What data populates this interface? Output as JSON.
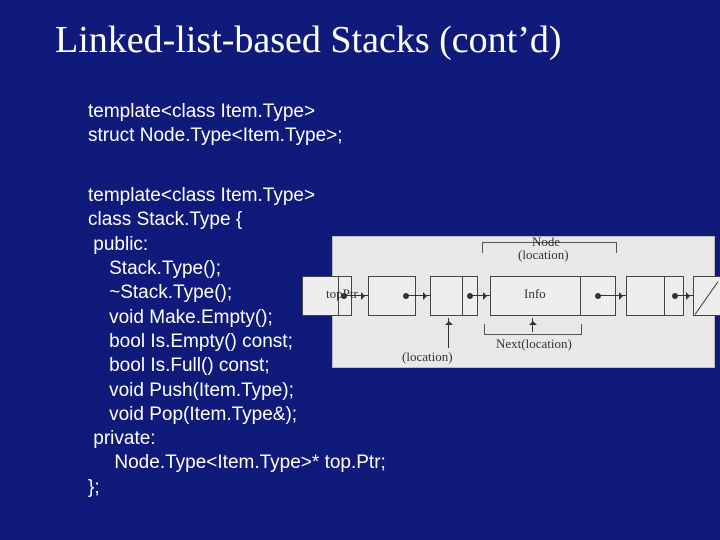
{
  "title": "Linked-list-based Stacks (cont’d)",
  "intro_lines": [
    "template<class Item.Type>",
    "struct Node.Type<Item.Type>;"
  ],
  "body_lines": [
    "template<class Item.Type>",
    "class Stack.Type {",
    " public:",
    "    Stack.Type();",
    "    ~Stack.Type();",
    "    void Make.Empty();",
    "    bool Is.Empty() const;",
    "    bool Is.Full() const;",
    "    void Push(Item.Type);",
    "    void Pop(Item.Type&);",
    " private:",
    "     Node.Type<Item.Type>* top.Ptr;",
    "};"
  ],
  "diagram": {
    "node_top_label": "Node",
    "node_sub_label": "(location)",
    "topptr_label": "topPtr",
    "info_label": "Info",
    "next_label": "Next(location)",
    "loc_label": "(location)"
  }
}
